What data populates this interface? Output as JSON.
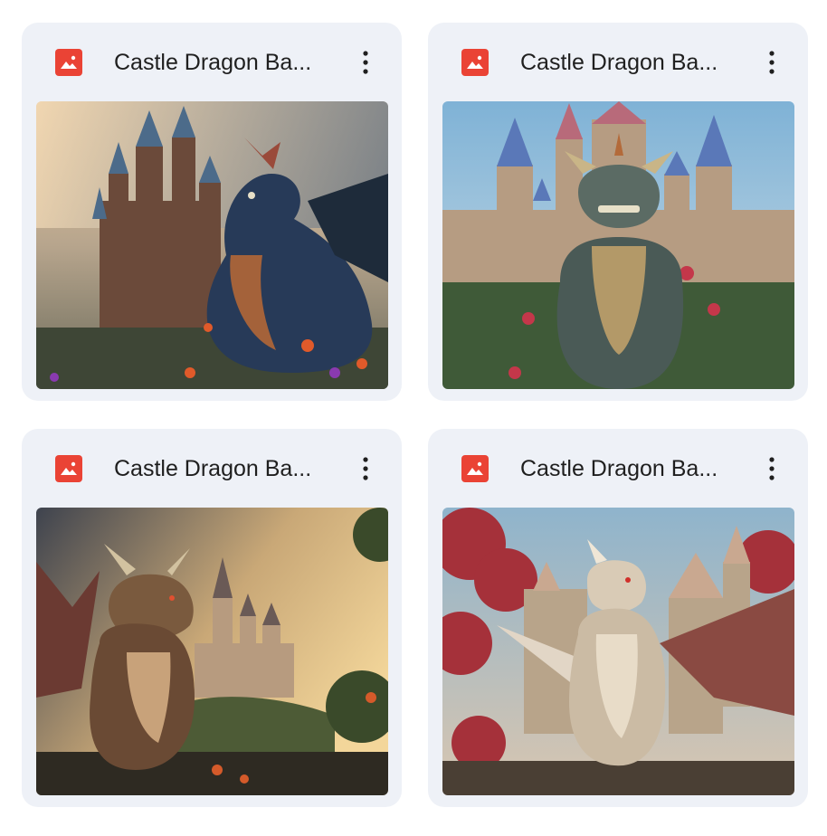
{
  "files": [
    {
      "name": "Castle Dragon Ba...",
      "icon": "image-file-icon",
      "thumbnail": "dragon-blue-castle",
      "accent": "#ea4335"
    },
    {
      "name": "Castle Dragon Ba...",
      "icon": "image-file-icon",
      "thumbnail": "dragon-stone-castle",
      "accent": "#ea4335"
    },
    {
      "name": "Castle Dragon Ba...",
      "icon": "image-file-icon",
      "thumbnail": "dragon-sunset-castle",
      "accent": "#ea4335"
    },
    {
      "name": "Castle Dragon Ba...",
      "icon": "image-file-icon",
      "thumbnail": "dragon-white-castle",
      "accent": "#ea4335"
    }
  ],
  "more_icon": "more-vert-icon",
  "card_background": "#eef1f7"
}
